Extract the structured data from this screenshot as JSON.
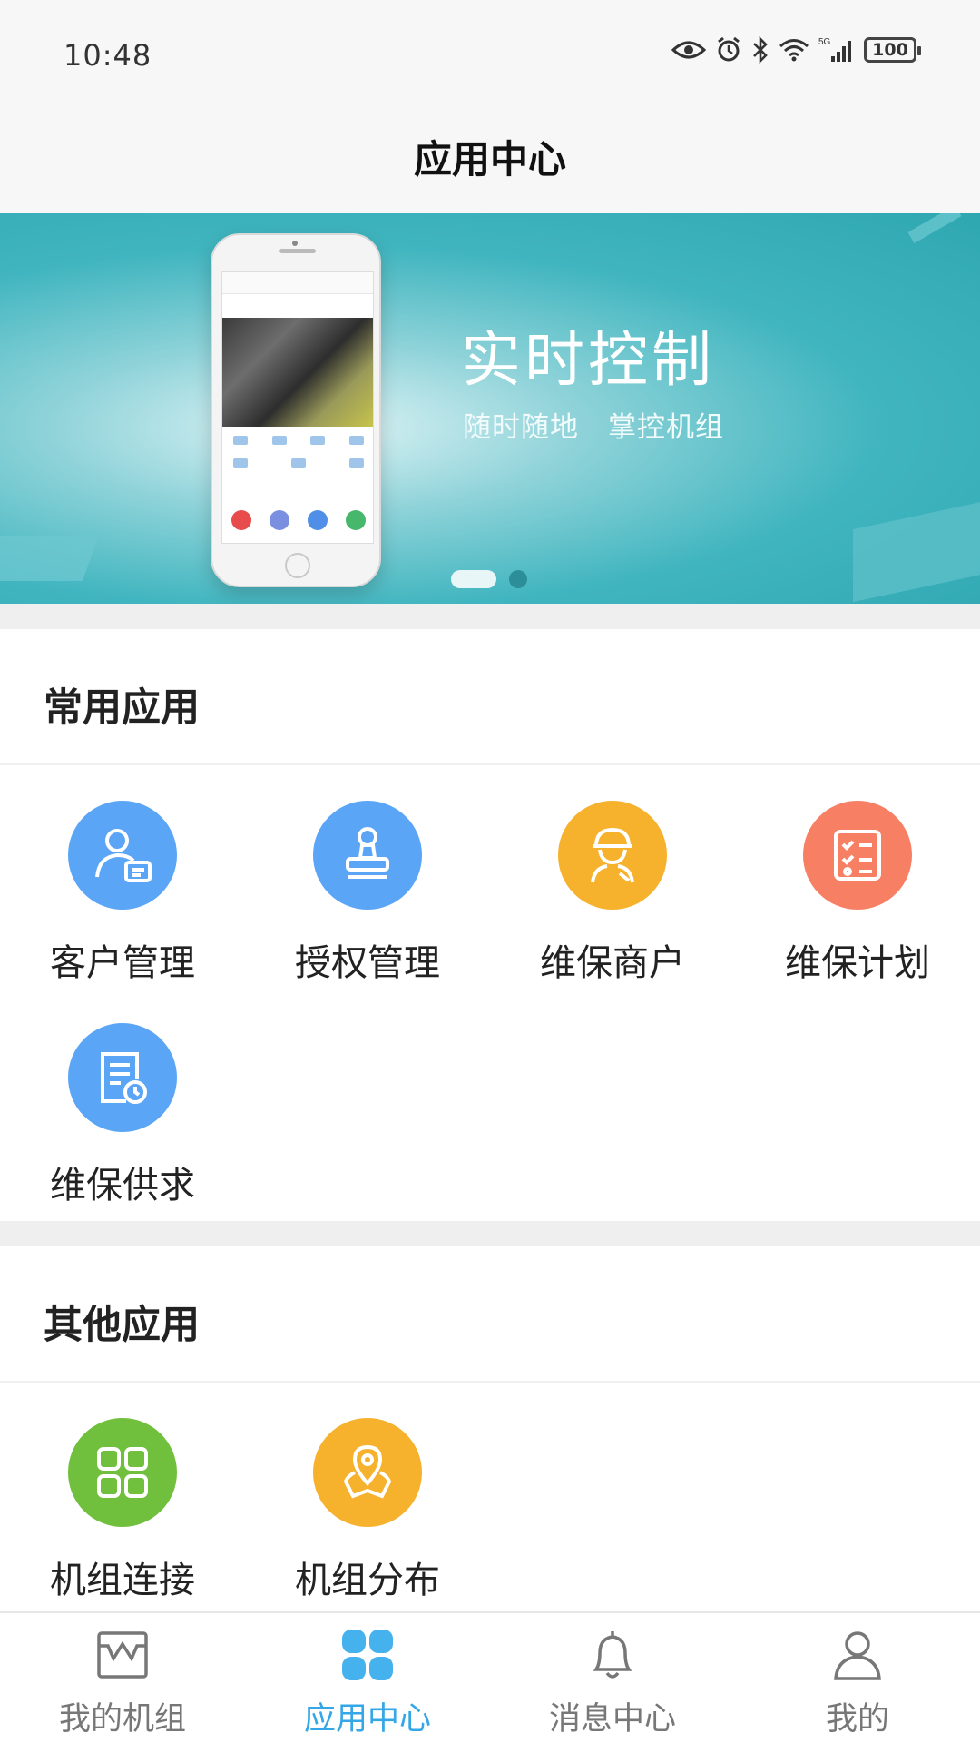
{
  "status_bar": {
    "time": "10:48",
    "network": "5G",
    "battery": "100",
    "icons": [
      "eye-icon",
      "alarm-icon",
      "bluetooth-icon",
      "wifi-icon",
      "signal-icon",
      "battery-icon"
    ]
  },
  "header": {
    "title": "应用中心"
  },
  "banner": {
    "title": "实时控制",
    "subtitle": "随时随地　掌控机组",
    "colors": {
      "background": "#35aeb8"
    },
    "page_indicator": {
      "pages": 2,
      "current": 1
    }
  },
  "sections": [
    {
      "title": "常用应用",
      "apps": [
        {
          "label": "客户管理",
          "icon": "customer-icon",
          "color": "#5aa5f5"
        },
        {
          "label": "授权管理",
          "icon": "stamp-icon",
          "color": "#5aa5f5"
        },
        {
          "label": "维保商户",
          "icon": "technician-icon",
          "color": "#f6b12d"
        },
        {
          "label": "维保计划",
          "icon": "checklist-icon",
          "color": "#f77f64"
        },
        {
          "label": "维保供求",
          "icon": "document-clock-icon",
          "color": "#5aa5f5"
        }
      ]
    },
    {
      "title": "其他应用",
      "apps": [
        {
          "label": "机组连接",
          "icon": "grid-icon",
          "color": "#71c03d"
        },
        {
          "label": "机组分布",
          "icon": "map-pin-icon",
          "color": "#f6b12d"
        }
      ]
    }
  ],
  "tabbar": {
    "active_color": "#35a7e6",
    "items": [
      {
        "label": "我的机组",
        "icon": "unit-icon",
        "active": false
      },
      {
        "label": "应用中心",
        "icon": "clover-icon",
        "active": true
      },
      {
        "label": "消息中心",
        "icon": "bell-icon",
        "active": false
      },
      {
        "label": "我的",
        "icon": "person-icon",
        "active": false
      }
    ]
  }
}
